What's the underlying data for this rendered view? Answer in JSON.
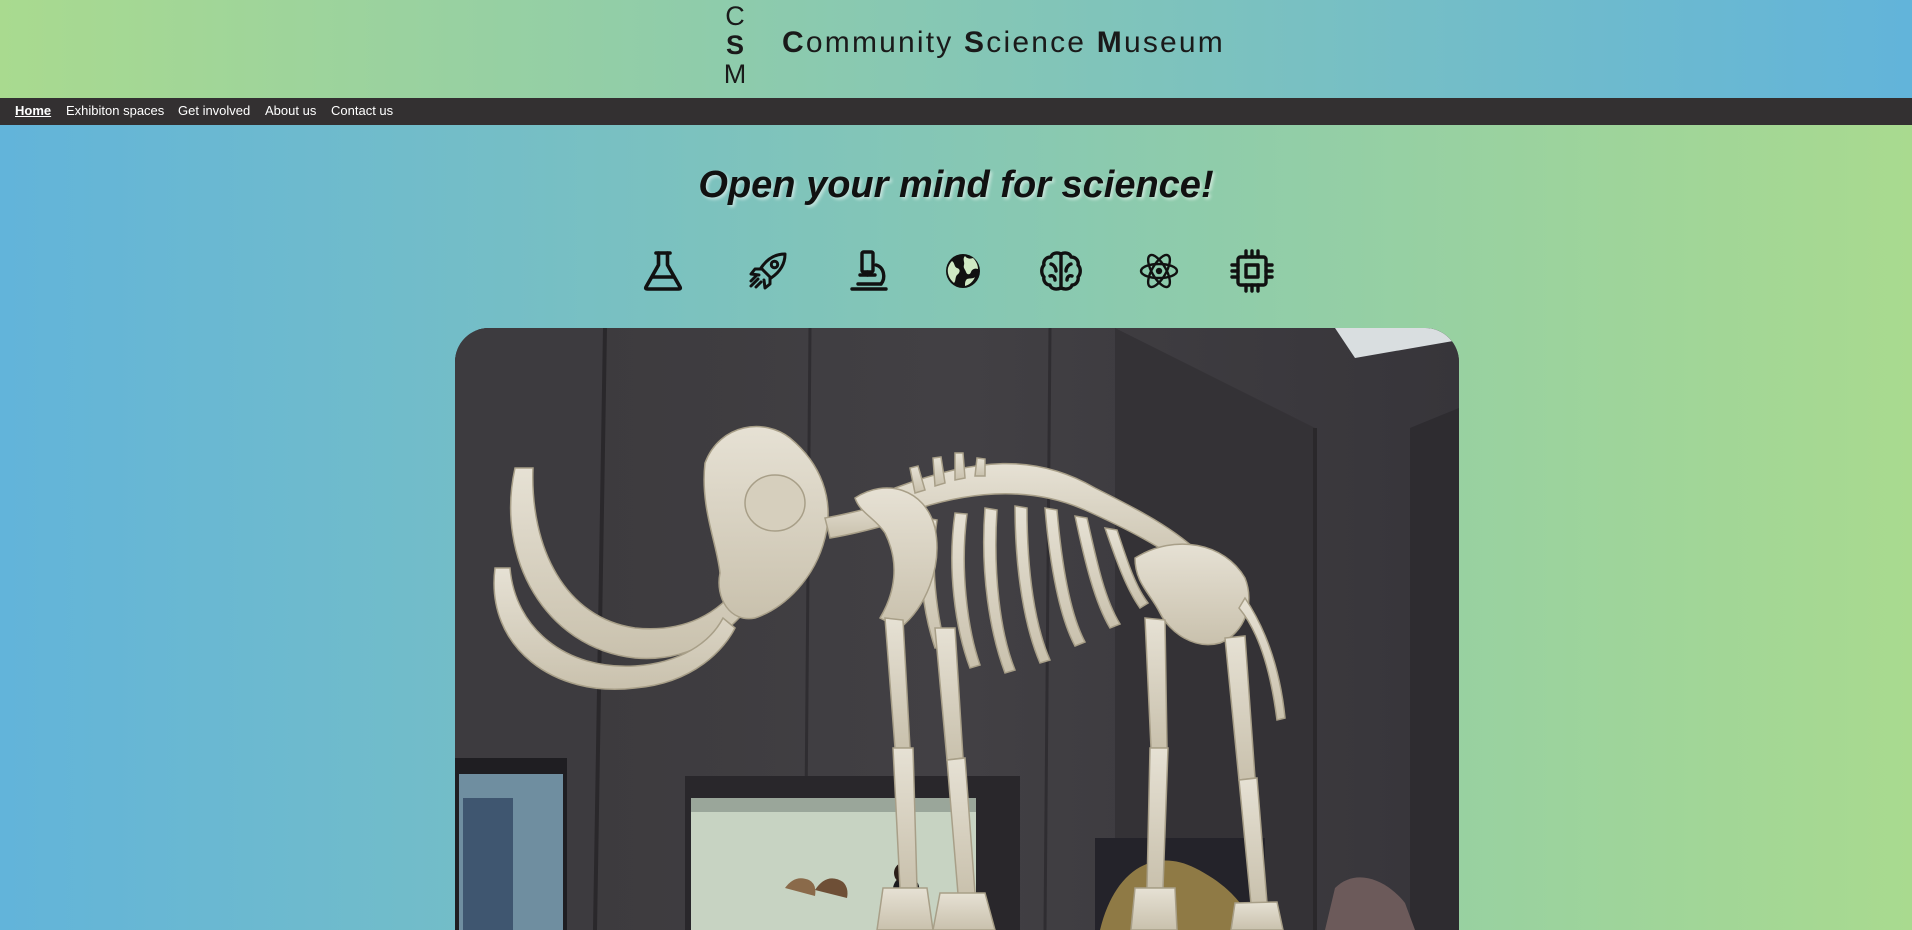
{
  "header": {
    "logo_letters": [
      "C",
      "S",
      "M"
    ],
    "title_parts": [
      {
        "initial": "C",
        "rest": "ommunity "
      },
      {
        "initial": "S",
        "rest": "cience "
      },
      {
        "initial": "M",
        "rest": "useum"
      }
    ]
  },
  "nav": {
    "items": [
      {
        "label": "Home",
        "active": true
      },
      {
        "label": "Exhibiton spaces",
        "active": false
      },
      {
        "label": "Get involved",
        "active": false
      },
      {
        "label": "About us",
        "active": false
      },
      {
        "label": "Contact us",
        "active": false
      }
    ]
  },
  "main": {
    "tagline": "Open your mind for science!",
    "icons": [
      "flask-icon",
      "rocket-icon",
      "microscope-icon",
      "globe-icon",
      "brain-icon",
      "atom-icon",
      "chip-icon"
    ],
    "hero_image": "mammoth-skeleton-image"
  },
  "colors": {
    "header_gradient": [
      "#a9da8f",
      "#62b4da"
    ],
    "body_gradient": [
      "#62b4da",
      "#a9da8f"
    ],
    "nav_background": "#333031",
    "text": "#111111"
  }
}
